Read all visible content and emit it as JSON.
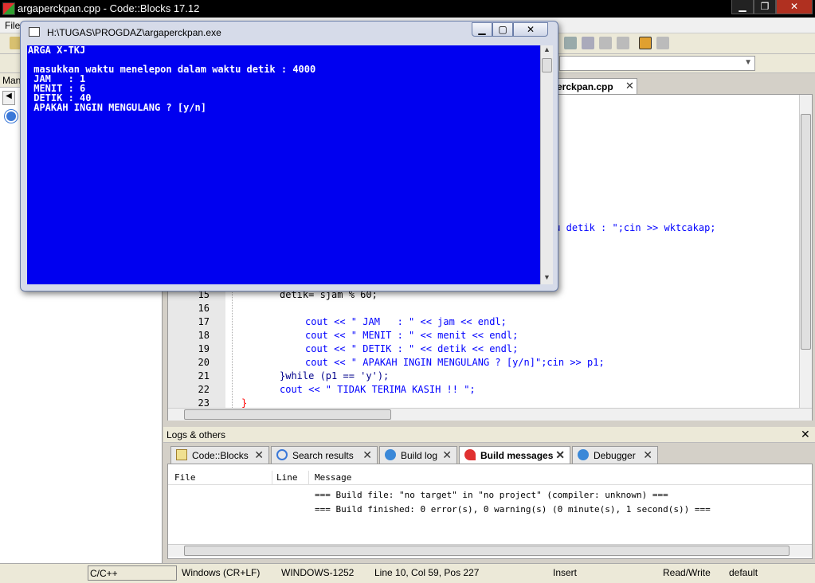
{
  "main_window": {
    "title": "argaperckpan.cpp - Code::Blocks 17.12",
    "menu": [
      "File"
    ]
  },
  "editor": {
    "tab_label": "erckpan.cpp",
    "partial_line_text": "tu detik : \";cin >> wktcakap;",
    "lines": [
      {
        "n": "15",
        "text": "detik= sjam % 60;"
      },
      {
        "n": "16",
        "text": ""
      },
      {
        "n": "17",
        "text": "cout << \" JAM   : \" << jam << endl;"
      },
      {
        "n": "18",
        "text": "cout << \" MENIT : \" << menit << endl;"
      },
      {
        "n": "19",
        "text": "cout << \" DETIK : \" << detik << endl;"
      },
      {
        "n": "20",
        "text": "cout << \" APAKAH INGIN MENGULANG ? [y/n]\";cin >> p1;"
      },
      {
        "n": "21",
        "text": "}while (p1 == 'y');"
      },
      {
        "n": "22",
        "text": "cout << \" TIDAK TERIMA KASIH !! \";"
      },
      {
        "n": "23",
        "text": "}"
      }
    ]
  },
  "left_pane": {
    "header": "Mana"
  },
  "logs": {
    "header": "Logs & others",
    "tabs": [
      {
        "label": "Code::Blocks",
        "icon": "note-icon"
      },
      {
        "label": "Search results",
        "icon": "magnifier-icon"
      },
      {
        "label": "Build log",
        "icon": "gear-icon"
      },
      {
        "label": "Build messages",
        "icon": "pin-icon",
        "active": true
      },
      {
        "label": "Debugger",
        "icon": "gear-icon"
      }
    ],
    "columns": [
      "File",
      "Line",
      "Message"
    ],
    "messages": [
      "=== Build file: \"no target\" in \"no project\" (compiler: unknown) ===",
      "=== Build finished: 0 error(s), 0 warning(s) (0 minute(s), 1 second(s)) ==="
    ]
  },
  "statusbar": {
    "language": "C/C++",
    "line_endings": "Windows (CR+LF)",
    "encoding": "WINDOWS-1252",
    "position": "Line 10, Col 59, Pos 227",
    "insert_mode": "Insert",
    "access": "Read/Write",
    "profile": "default"
  },
  "console": {
    "title": "H:\\TUGAS\\PROGDAZ\\argaperckpan.exe",
    "output": "ARGA X-TKJ\n\n masukkan waktu menelepon dalam waktu detik : 4000\n JAM   : 1\n MENIT : 6\n DETIK : 40\n APAKAH INGIN MENGULANG ? [y/n]"
  },
  "colors": {
    "console_bg": "#0000f0",
    "keyword": "#00008b",
    "string": "#0000ff",
    "operator": "#ff0000"
  }
}
